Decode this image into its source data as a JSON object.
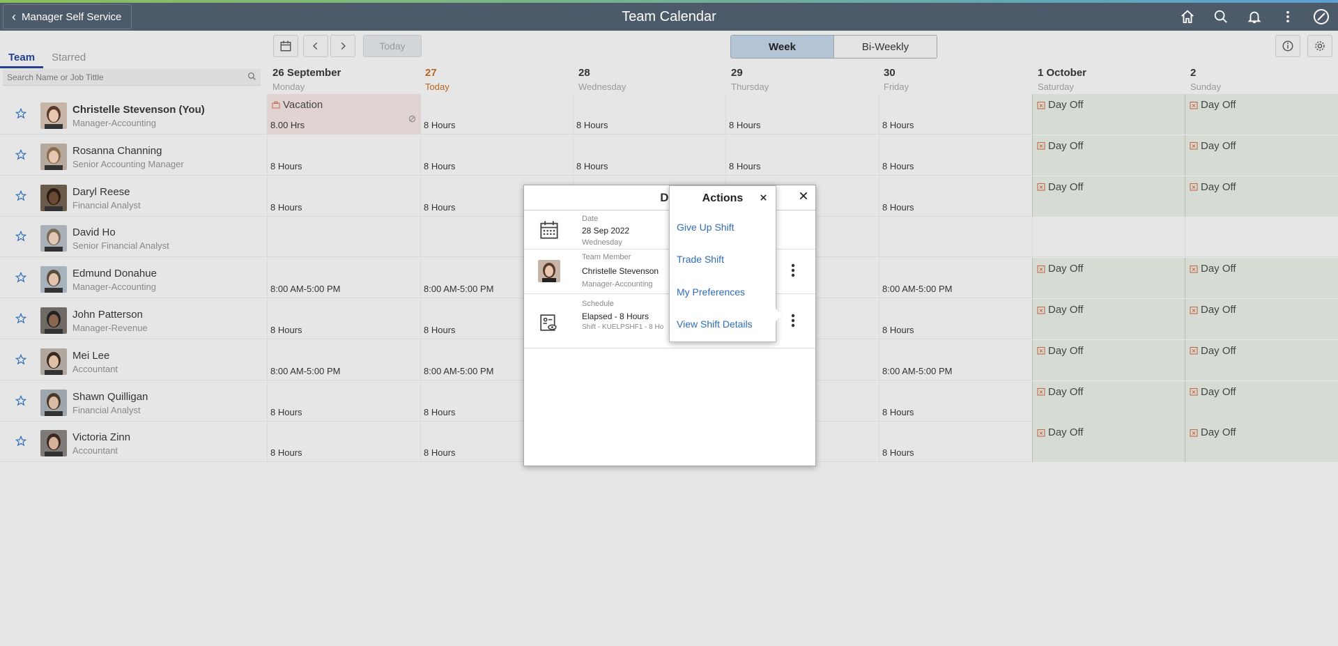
{
  "header": {
    "back_label": "Manager Self Service",
    "title": "Team Calendar"
  },
  "left_panel": {
    "tabs": [
      "Team",
      "Starred"
    ],
    "search_placeholder": "Search Name or Job Tittle"
  },
  "toolbar": {
    "today_label": "Today",
    "view_options": [
      "Week",
      "Bi-Weekly"
    ],
    "selected_view": "Week"
  },
  "days": [
    {
      "num": "26 September",
      "name": "Monday"
    },
    {
      "num": "27",
      "name": "Today"
    },
    {
      "num": "28",
      "name": "Wednesday"
    },
    {
      "num": "29",
      "name": "Thursday"
    },
    {
      "num": "30",
      "name": "Friday"
    },
    {
      "num": "1 October",
      "name": "Saturday"
    },
    {
      "num": "2",
      "name": "Sunday"
    }
  ],
  "employees": [
    {
      "name": "Christelle Stevenson (You)",
      "job": "Manager-Accounting",
      "cells": [
        "8.00 Hrs",
        "8 Hours",
        "8 Hours",
        "8 Hours",
        "8 Hours",
        "",
        ""
      ]
    },
    {
      "name": "Rosanna Channing",
      "job": "Senior Accounting Manager",
      "cells": [
        "8 Hours",
        "8 Hours",
        "8 Hours",
        "8 Hours",
        "8 Hours",
        "",
        ""
      ]
    },
    {
      "name": "Daryl Reese",
      "job": "Financial Analyst",
      "cells": [
        "8 Hours",
        "8 Hours",
        "",
        "",
        "8 Hours",
        "",
        ""
      ]
    },
    {
      "name": "David Ho",
      "job": "Senior Financial Analyst",
      "cells": [
        "",
        "",
        "",
        "",
        "",
        "",
        ""
      ]
    },
    {
      "name": "Edmund Donahue",
      "job": "Manager-Accounting",
      "cells": [
        "8:00 AM-5:00 PM",
        "8:00 AM-5:00 PM",
        "",
        "",
        "8:00 AM-5:00 PM",
        "",
        ""
      ]
    },
    {
      "name": "John Patterson",
      "job": "Manager-Revenue",
      "cells": [
        "8 Hours",
        "8 Hours",
        "",
        "",
        "8 Hours",
        "",
        ""
      ]
    },
    {
      "name": "Mei Lee",
      "job": "Accountant",
      "cells": [
        "8:00 AM-5:00 PM",
        "8:00 AM-5:00 PM",
        "",
        "",
        "8:00 AM-5:00 PM",
        "",
        ""
      ]
    },
    {
      "name": "Shawn Quilligan",
      "job": "Financial Analyst",
      "cells": [
        "8 Hours",
        "8 Hours",
        "",
        "",
        "8 Hours",
        "",
        ""
      ]
    },
    {
      "name": "Victoria Zinn",
      "job": "Accountant",
      "cells": [
        "8 Hours",
        "8 Hours",
        "",
        "",
        "8 Hours",
        "",
        ""
      ]
    }
  ],
  "vacation_label": "Vacation",
  "day_off_label": "Day Off",
  "details_modal": {
    "title": "Det",
    "date_label": "Date",
    "date_value": "28 Sep 2022",
    "date_day": "Wednesday",
    "member_label": "Team Member",
    "member_name": "Christelle Stevenson",
    "member_job": "Manager-Accounting",
    "schedule_label": "Schedule",
    "schedule_value": "Elapsed - 8 Hours",
    "schedule_sub": "Shift - KUELPSHF1 - 8 Ho"
  },
  "actions_popup": {
    "title": "Actions",
    "items": [
      "Give Up Shift",
      "Trade Shift",
      "My Preferences",
      "View Shift Details"
    ]
  },
  "colors": {
    "header_bg": "#4d5a6a",
    "link": "#2d6db5",
    "today": "#b8651f",
    "day_off_bg": "#d6dbd3",
    "vacation_bg": "#e2d3d3"
  }
}
